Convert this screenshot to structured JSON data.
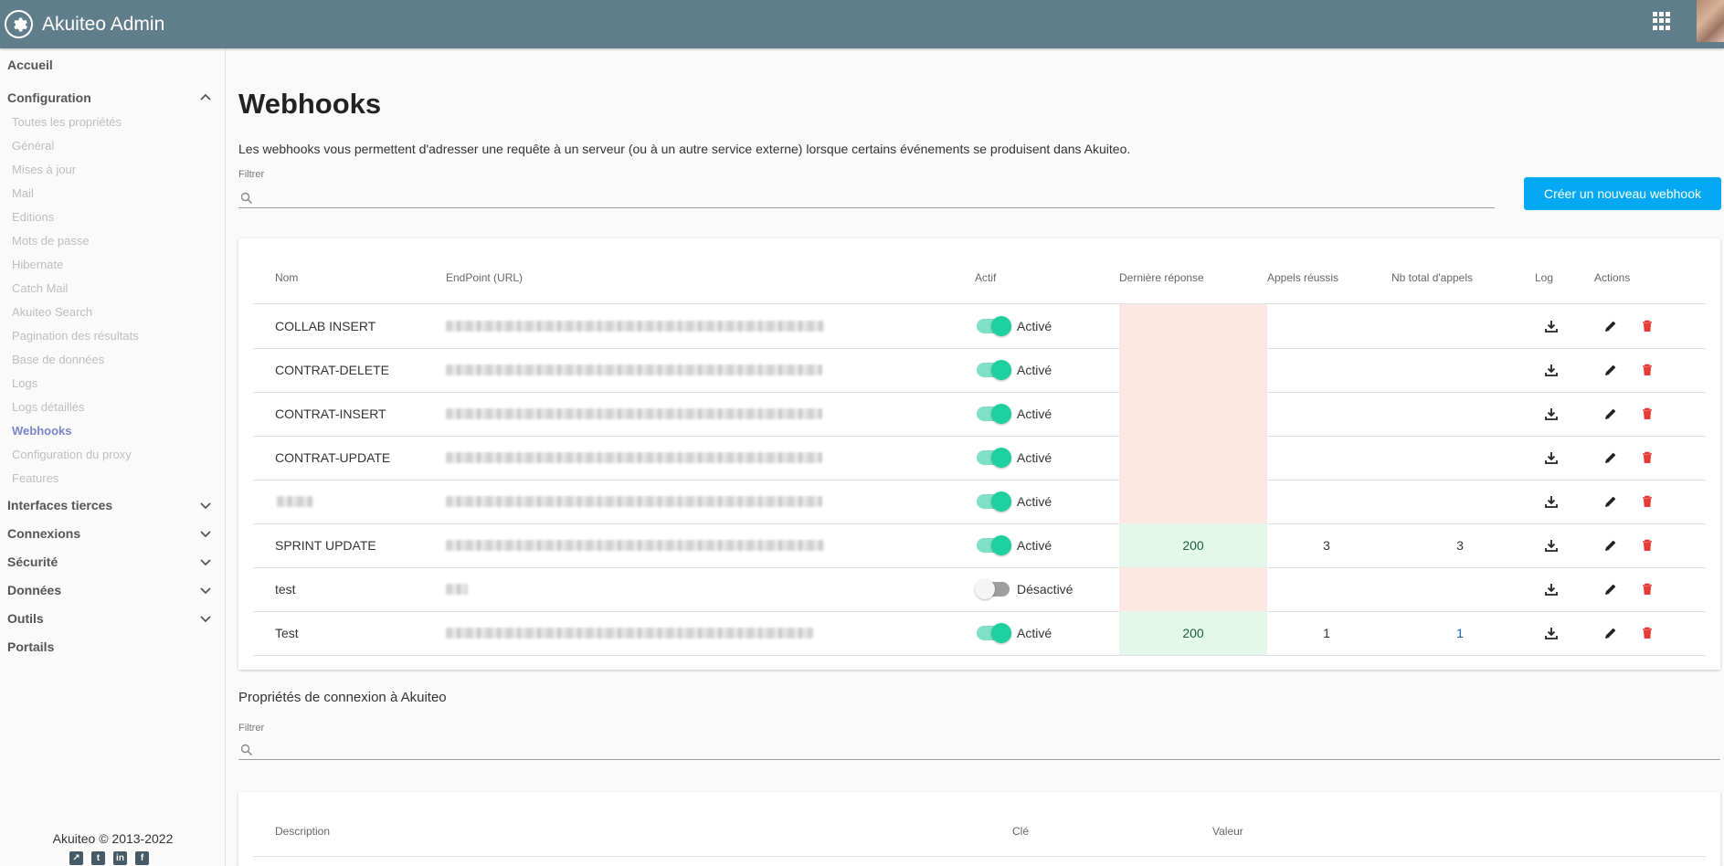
{
  "app": {
    "title": "Akuiteo Admin"
  },
  "sidebar": {
    "top": [
      {
        "label": "Accueil"
      },
      {
        "label": "Configuration"
      },
      {
        "label": "Interfaces tierces"
      },
      {
        "label": "Connexions"
      },
      {
        "label": "Sécurité"
      },
      {
        "label": "Données"
      },
      {
        "label": "Outils"
      },
      {
        "label": "Portails"
      }
    ],
    "config_items": [
      "Toutes les propriétés",
      "Général",
      "Mises à jour",
      "Mail",
      "Editions",
      "Mots de passe",
      "Hibernate",
      "Catch Mail",
      "Akuiteo Search",
      "Pagination des résultats",
      "Base de données",
      "Logs",
      "Logs détaillés",
      "Webhooks",
      "Configuration du proxy",
      "Features"
    ],
    "active_item": "Webhooks",
    "footer": "Akuiteo © 2013-2022",
    "socials": [
      "akuiteo-icon",
      "twitter-icon",
      "linkedin-icon",
      "facebook-icon"
    ]
  },
  "page": {
    "title": "Webhooks",
    "description": "Les webhooks vous permettent d'adresser une requête à un serveur (ou à un autre service externe) lorsque certains événements se produisent dans Akuiteo.",
    "filter_label": "Filtrer",
    "create_button": "Créer un nouveau webhook"
  },
  "webhooks_table": {
    "columns": [
      "Nom",
      "EndPoint (URL)",
      "Actif",
      "Dernière réponse",
      "Appels réussis",
      "Nb total d'appels",
      "Log",
      "Actions"
    ],
    "rows": [
      {
        "name": "COLLAB INSERT",
        "active": true,
        "status_label": "Activé",
        "last_response": "",
        "last_ok": false,
        "success": "",
        "total": ""
      },
      {
        "name": "CONTRAT-DELETE",
        "active": true,
        "status_label": "Activé",
        "last_response": "",
        "last_ok": false,
        "success": "",
        "total": ""
      },
      {
        "name": "CONTRAT-INSERT",
        "active": true,
        "status_label": "Activé",
        "last_response": "",
        "last_ok": false,
        "success": "",
        "total": ""
      },
      {
        "name": "CONTRAT-UPDATE",
        "active": true,
        "status_label": "Activé",
        "last_response": "",
        "last_ok": false,
        "success": "",
        "total": ""
      },
      {
        "name": "",
        "active": true,
        "status_label": "Activé",
        "last_response": "",
        "last_ok": false,
        "success": "",
        "total": ""
      },
      {
        "name": "SPRINT UPDATE",
        "active": true,
        "status_label": "Activé",
        "last_response": "200",
        "last_ok": true,
        "success": "3",
        "total": "3"
      },
      {
        "name": "test",
        "active": false,
        "status_label": "Désactivé",
        "last_response": "",
        "last_ok": false,
        "success": "",
        "total": ""
      },
      {
        "name": "Test",
        "active": true,
        "status_label": "Activé",
        "last_response": "200",
        "last_ok": true,
        "success": "1",
        "total": "1"
      }
    ]
  },
  "connection_section": {
    "title": "Propriétés de connexion à Akuiteo",
    "filter_label": "Filtrer",
    "columns": [
      "Description",
      "Clé",
      "Valeur"
    ]
  },
  "colors": {
    "topbar": "#607d8b",
    "accent": "#03a9f4",
    "toggle_on": "#1dd1a1",
    "error_cell": "#fde7e1",
    "ok_cell": "#e3f7ea",
    "delete_icon": "#e53935"
  }
}
